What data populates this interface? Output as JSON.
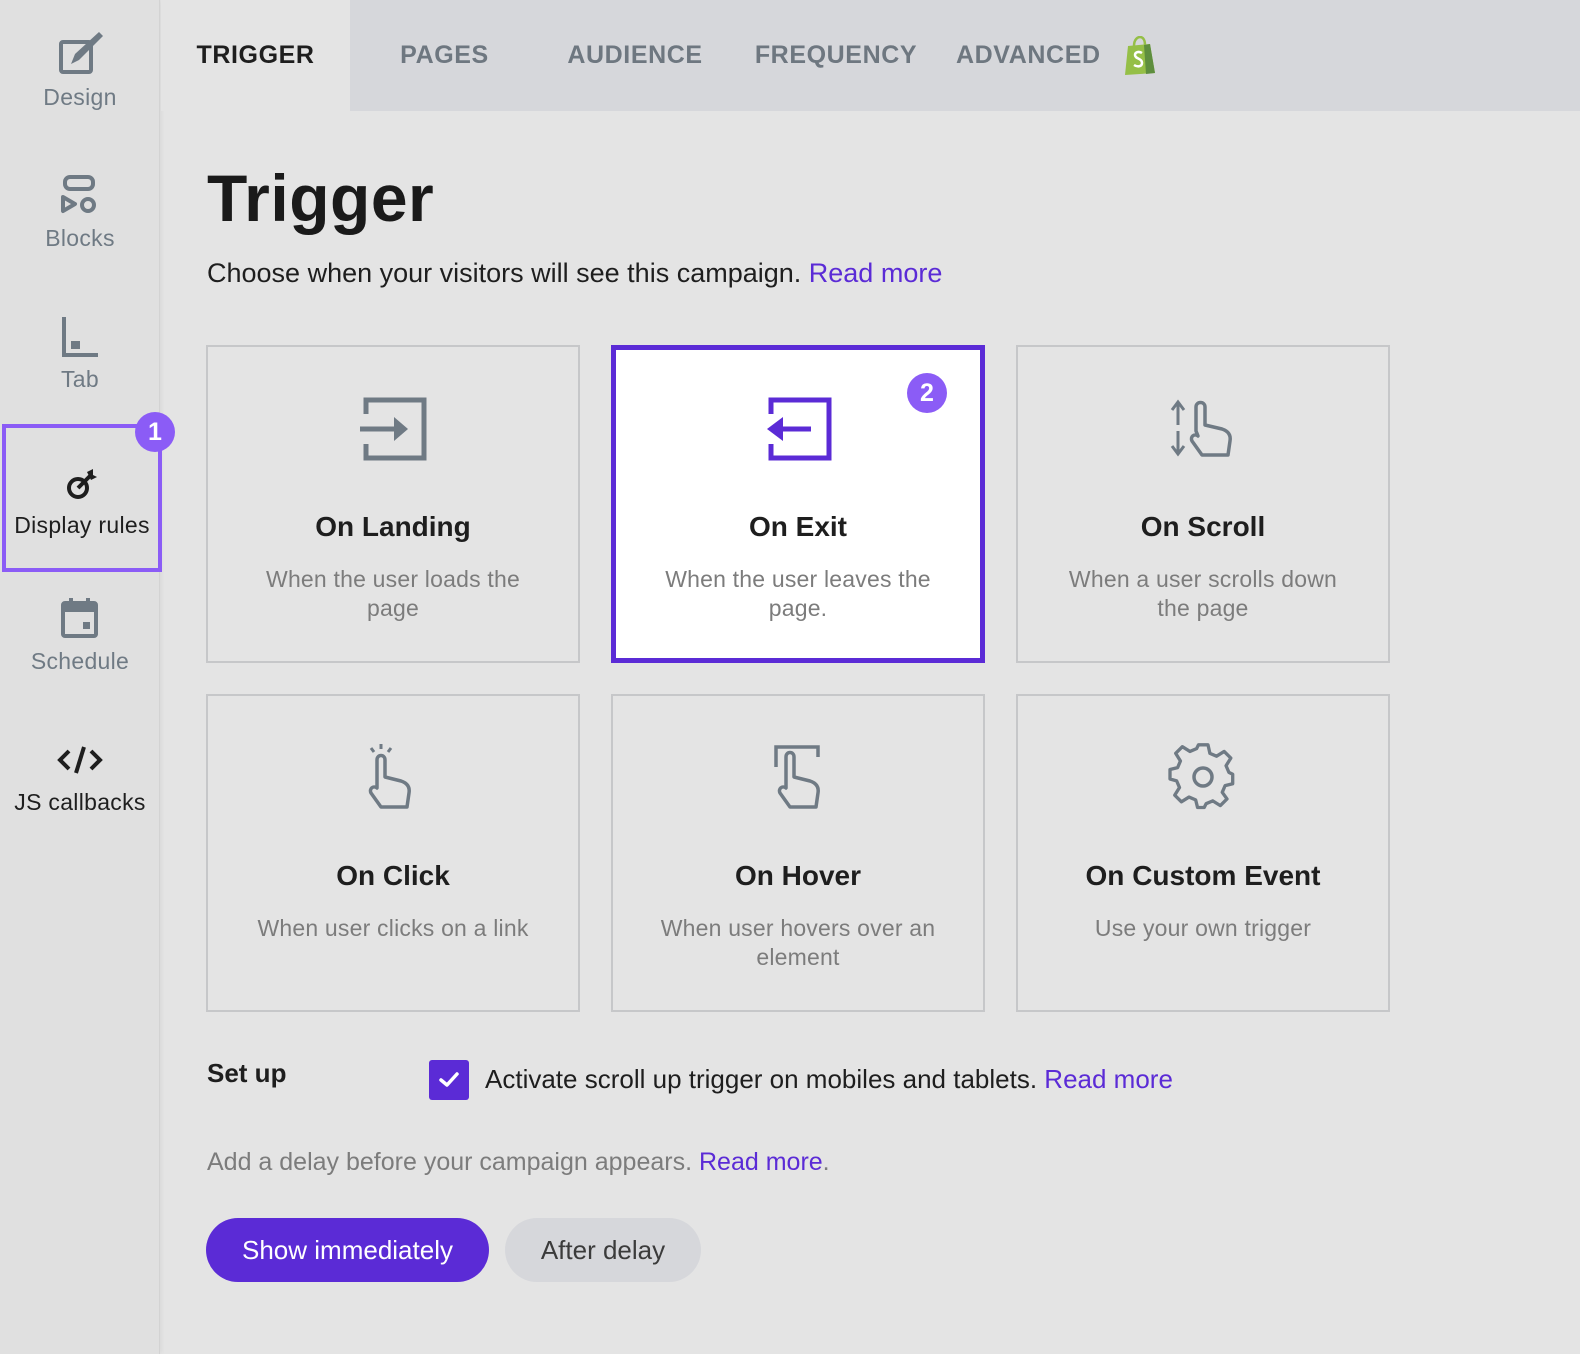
{
  "sidebar": {
    "items": [
      {
        "label": "Design",
        "icon": "design-brush-icon"
      },
      {
        "label": "Blocks",
        "icon": "blocks-icon"
      },
      {
        "label": "Tab",
        "icon": "tab-icon"
      },
      {
        "label": "Display rules",
        "icon": "display-rules-icon",
        "active": true,
        "badge": "1"
      },
      {
        "label": "Schedule",
        "icon": "calendar-icon"
      },
      {
        "label": "JS callbacks",
        "icon": "code-icon"
      }
    ]
  },
  "tabs": [
    {
      "label": "TRIGGER",
      "active": true
    },
    {
      "label": "PAGES"
    },
    {
      "label": "AUDIENCE"
    },
    {
      "label": "FREQUENCY"
    },
    {
      "label": "ADVANCED",
      "icon": "shopify-bag-icon"
    }
  ],
  "main": {
    "title": "Trigger",
    "subtitle": "Choose when your visitors will see this campaign.",
    "subtitle_link": "Read more",
    "cards": [
      {
        "title": "On Landing",
        "desc": "When the user loads the page",
        "icon": "enter-arrow-icon"
      },
      {
        "title": "On Exit",
        "desc": "When the user leaves the page.",
        "icon": "exit-arrow-icon",
        "selected": true,
        "badge": "2"
      },
      {
        "title": "On Scroll",
        "desc": "When a user scrolls down the page",
        "icon": "scroll-hand-icon"
      },
      {
        "title": "On Click",
        "desc": "When user clicks on a link",
        "icon": "click-hand-icon"
      },
      {
        "title": "On Hover",
        "desc": "When user hovers over an element",
        "icon": "hover-hand-icon"
      },
      {
        "title": "On Custom Event",
        "desc": "Use your own trigger",
        "icon": "gear-icon"
      }
    ],
    "setup": {
      "label": "Set up",
      "checkbox_checked": true,
      "checkbox_text": "Activate scroll up trigger on mobiles and tablets.",
      "checkbox_link": "Read more"
    },
    "delay": {
      "text": "Add a delay before your campaign appears.",
      "link": "Read more",
      "suffix": "."
    },
    "buttons": {
      "primary": "Show immediately",
      "secondary": "After delay"
    }
  },
  "colors": {
    "accent": "#5b2bd6",
    "highlight": "#8b5cf6",
    "shopify_green": "#95bf47"
  }
}
